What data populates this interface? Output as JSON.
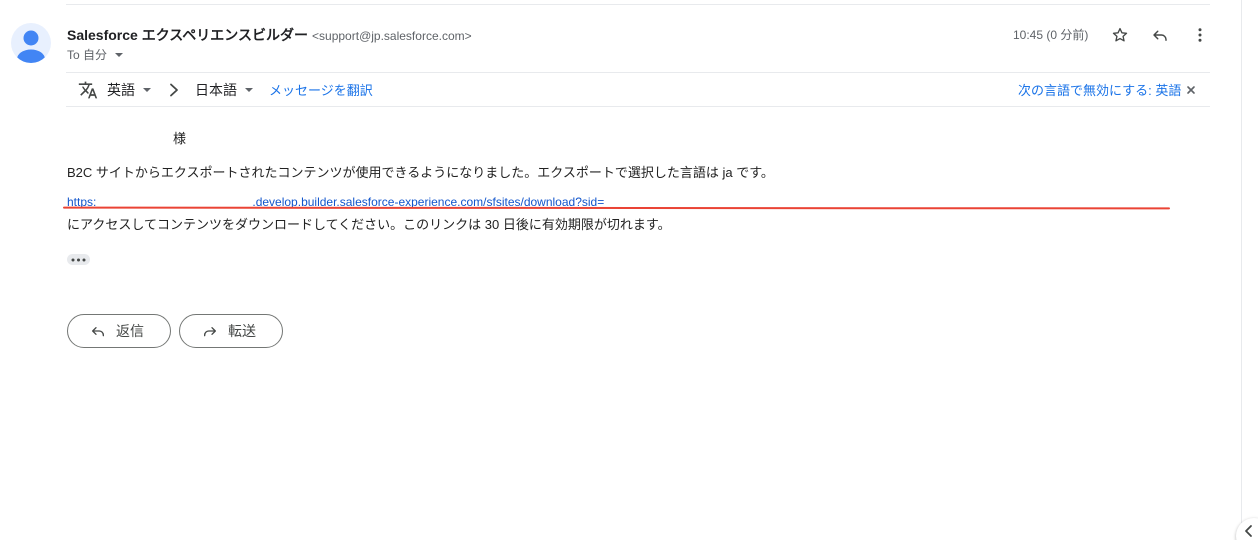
{
  "sender": {
    "name": "Salesforce エクスペリエンスビルダー",
    "email": "<support@jp.salesforce.com>",
    "to_label": "To 自分",
    "timestamp": "10:45 (0 分前)"
  },
  "header_icons": [
    "star-icon",
    "reply-icon",
    "more-vert-icon"
  ],
  "translate_bar": {
    "source_lang": "英語",
    "target_lang": "日本語",
    "translate_link": "メッセージを翻訳",
    "disable_link": "次の言語で無効にする: 英語"
  },
  "message": {
    "greeting": "様",
    "line1": "B2C サイトからエクスポートされたコンテンツが使用できるようになりました。エクスポートで選択した言語は ja です。",
    "url_prefix": "https:",
    "url_suffix": ".develop.builder.salesforce-experience.com/sfsites/download?sid=",
    "line2": "にアクセスしてコンテンツをダウンロードしてください。このリンクは 30 日後に有効期限が切れます。"
  },
  "actions": {
    "reply_label": "返信",
    "forward_label": "転送"
  },
  "colors": {
    "link": "#1155cc",
    "accent": "#1a73e8",
    "annotation": "#ea4335"
  }
}
